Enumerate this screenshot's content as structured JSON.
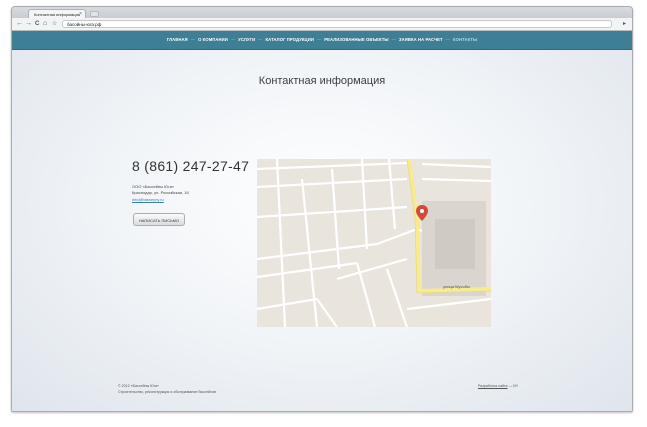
{
  "browser": {
    "tab_title": "Контактная информация",
    "tab_close": "×",
    "back": "←",
    "forward": "→",
    "reload": "C",
    "home": "⌂",
    "star": "☆",
    "url": "басойны-юга.рф",
    "go": "▸"
  },
  "nav": {
    "items": [
      "ГЛАВНАЯ",
      "О КОМПАНИИ",
      "УСЛУГИ",
      "КАТАЛОГ ПРОДУКЦИИ",
      "РЕАЛИЗОВАННЫЕ ОБЪЕКТЫ",
      "ЗАЯВКА НА РАСЧЕТ",
      "КОНТАКТЫ"
    ],
    "separator": "—",
    "active_index": 6
  },
  "page": {
    "title": "Контактная информация"
  },
  "contact": {
    "phone": "8 (861) 247-27-47",
    "company_line1": "ООО «Бассейны Юга»",
    "company_line2": "Краснодар, ул. Российская, 16",
    "email": "info@basseyny.ru",
    "button": "НАПИСАТЬ ПИСЬМО"
  },
  "map": {
    "street_label": "улица Мусобы",
    "marker": "map-pin"
  },
  "footer": {
    "copyright": "© 2012 «Бассейны Юга»",
    "tagline": "Строительство, реконструкция и обслуживание бассейнов",
    "credit_link": "Разработка сайта",
    "credit_suffix": "— NY"
  },
  "colors": {
    "nav_bg": "#3e7f96",
    "map_road": "#ffffff",
    "map_main_road": "#f6ec8d",
    "marker": "#d24a3b"
  }
}
